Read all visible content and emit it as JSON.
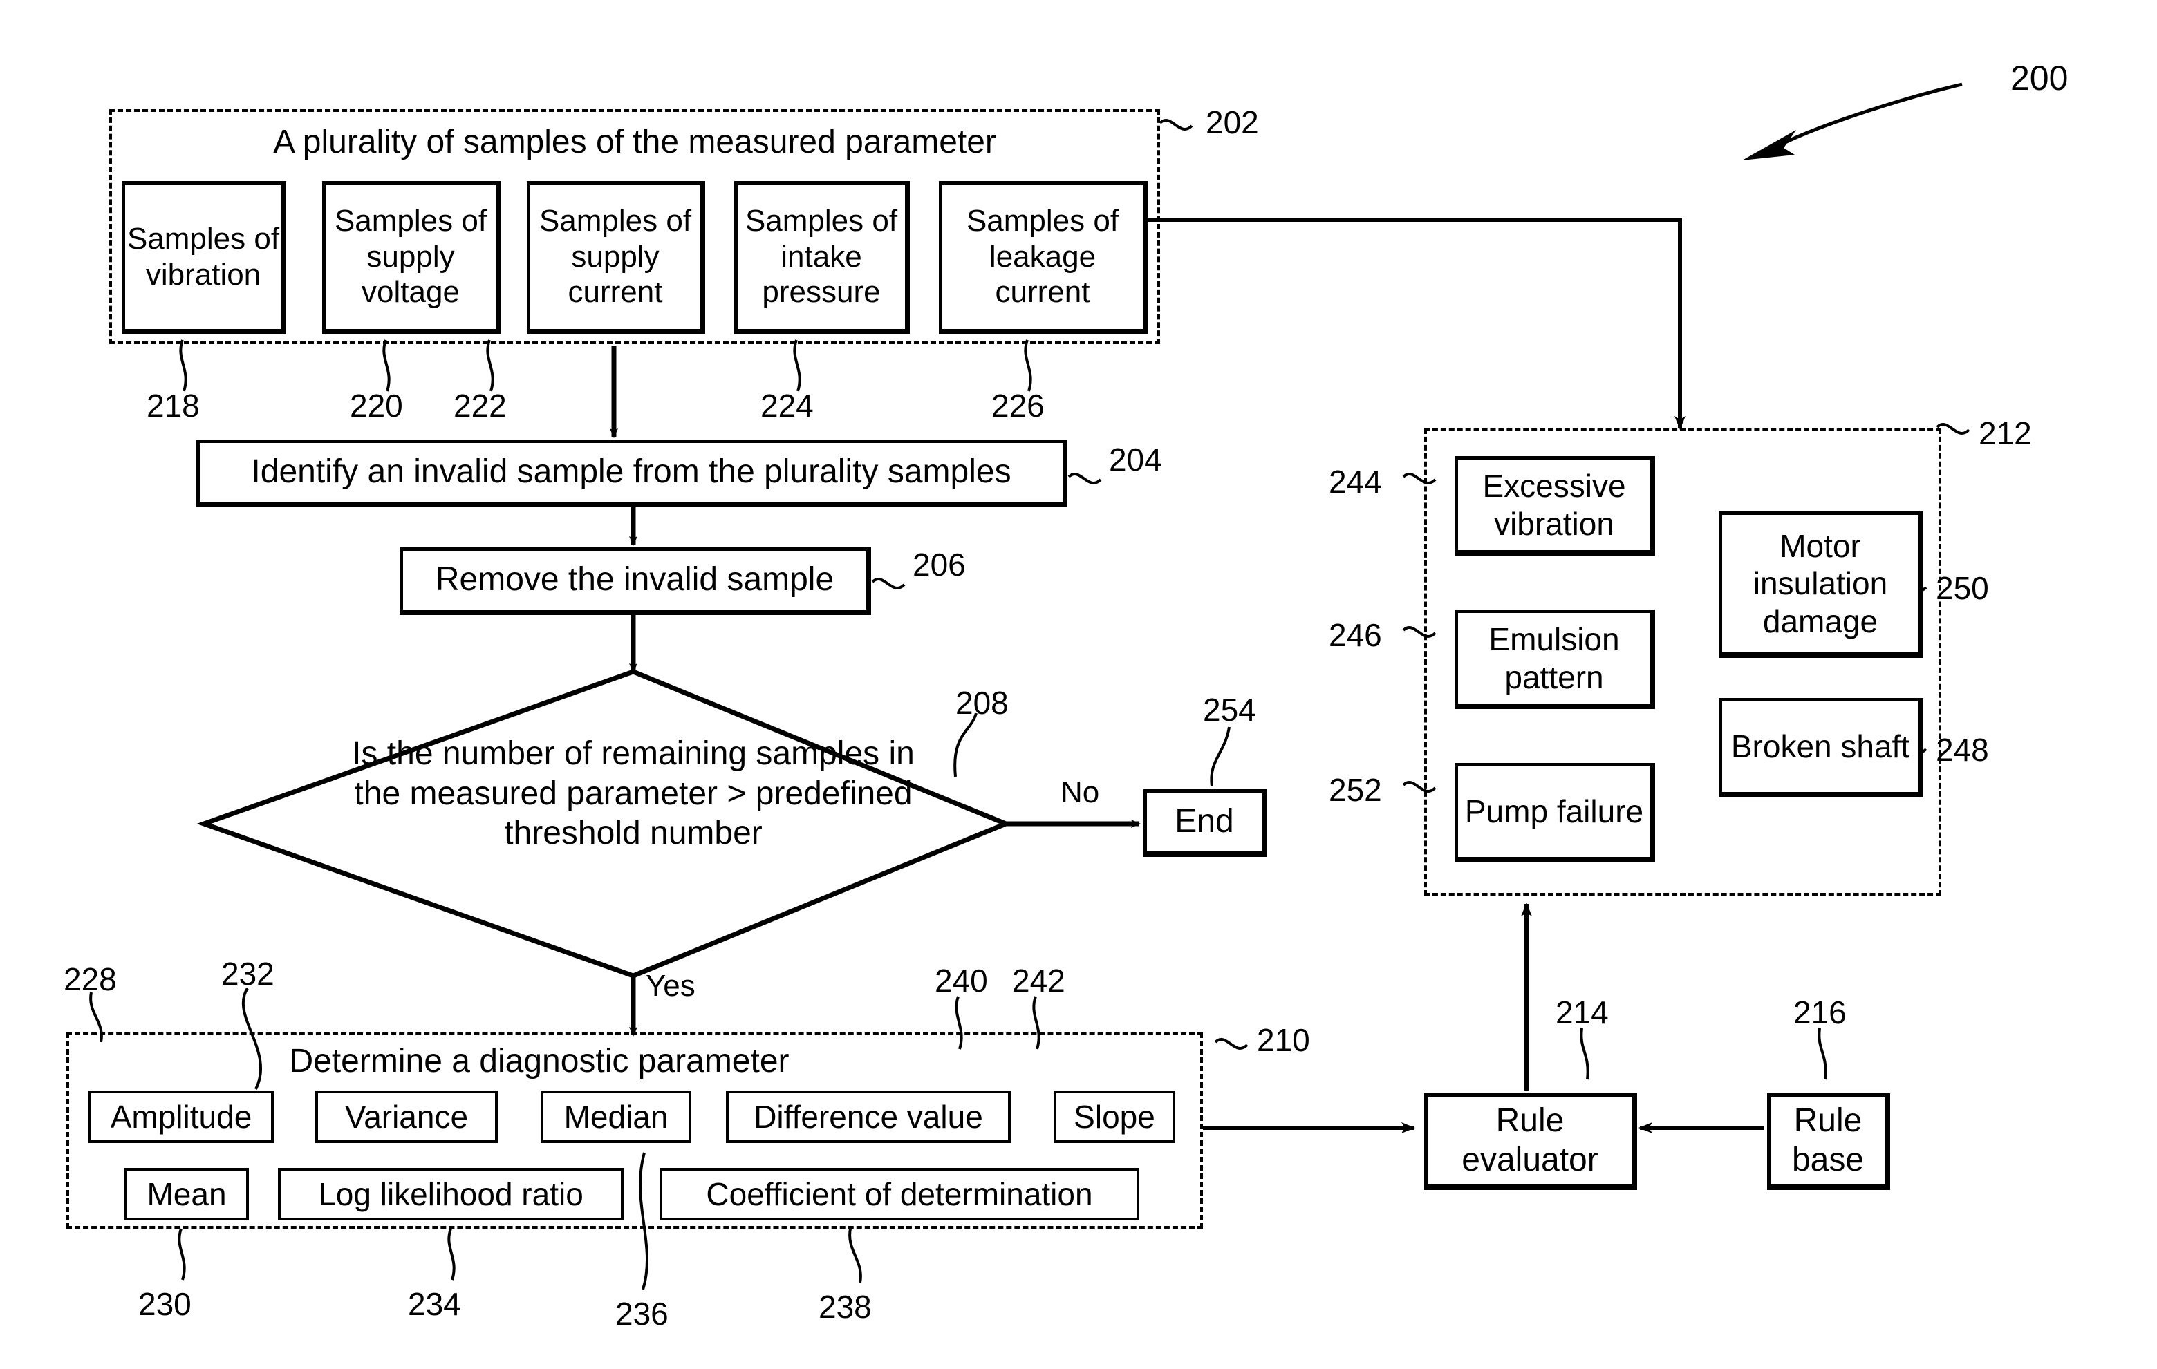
{
  "figure": {
    "number": "200"
  },
  "groups": {
    "samples": {
      "ref": "202",
      "title": "A plurality of samples of the measured parameter",
      "items": [
        {
          "label": "Samples of vibration",
          "ref": "218"
        },
        {
          "label": "Samples of supply voltage",
          "ref": "220"
        },
        {
          "label": "Samples of supply current",
          "ref": "222"
        },
        {
          "label": "Samples of intake pressure",
          "ref": "224"
        },
        {
          "label": "Samples of leakage current",
          "ref": "226"
        }
      ]
    },
    "diagnostic": {
      "ref": "210",
      "title": "Determine a diagnostic parameter",
      "items": [
        {
          "label": "Amplitude",
          "ref": "228"
        },
        {
          "label": "Variance",
          "ref": "232"
        },
        {
          "label": "Median",
          "ref": "236"
        },
        {
          "label": "Difference value",
          "ref": "240"
        },
        {
          "label": "Slope",
          "ref": "242"
        },
        {
          "label": "Mean",
          "ref": "230"
        },
        {
          "label": "Log likelihood ratio",
          "ref": "234"
        },
        {
          "label": "Coefficient of determination",
          "ref": "238"
        }
      ]
    },
    "faults": {
      "ref": "212",
      "items": [
        {
          "label": "Excessive vibration",
          "ref": "244"
        },
        {
          "label": "Emulsion pattern",
          "ref": "246"
        },
        {
          "label": "Pump failure",
          "ref": "252"
        },
        {
          "label": "Motor insulation damage",
          "ref": "250"
        },
        {
          "label": "Broken shaft",
          "ref": "248"
        }
      ]
    }
  },
  "steps": {
    "identify": {
      "label": "Identify an invalid sample from the plurality samples",
      "ref": "204"
    },
    "remove": {
      "label": "Remove the invalid sample",
      "ref": "206"
    },
    "decision": {
      "label": "Is the number of remaining samples in the measured parameter > predefined threshold number",
      "ref": "208",
      "no_label": "No",
      "yes_label": "Yes"
    },
    "end": {
      "label": "End",
      "ref": "254"
    },
    "rule_evaluator": {
      "label": "Rule evaluator",
      "ref": "214"
    },
    "rule_base": {
      "label": "Rule base",
      "ref": "216"
    }
  }
}
